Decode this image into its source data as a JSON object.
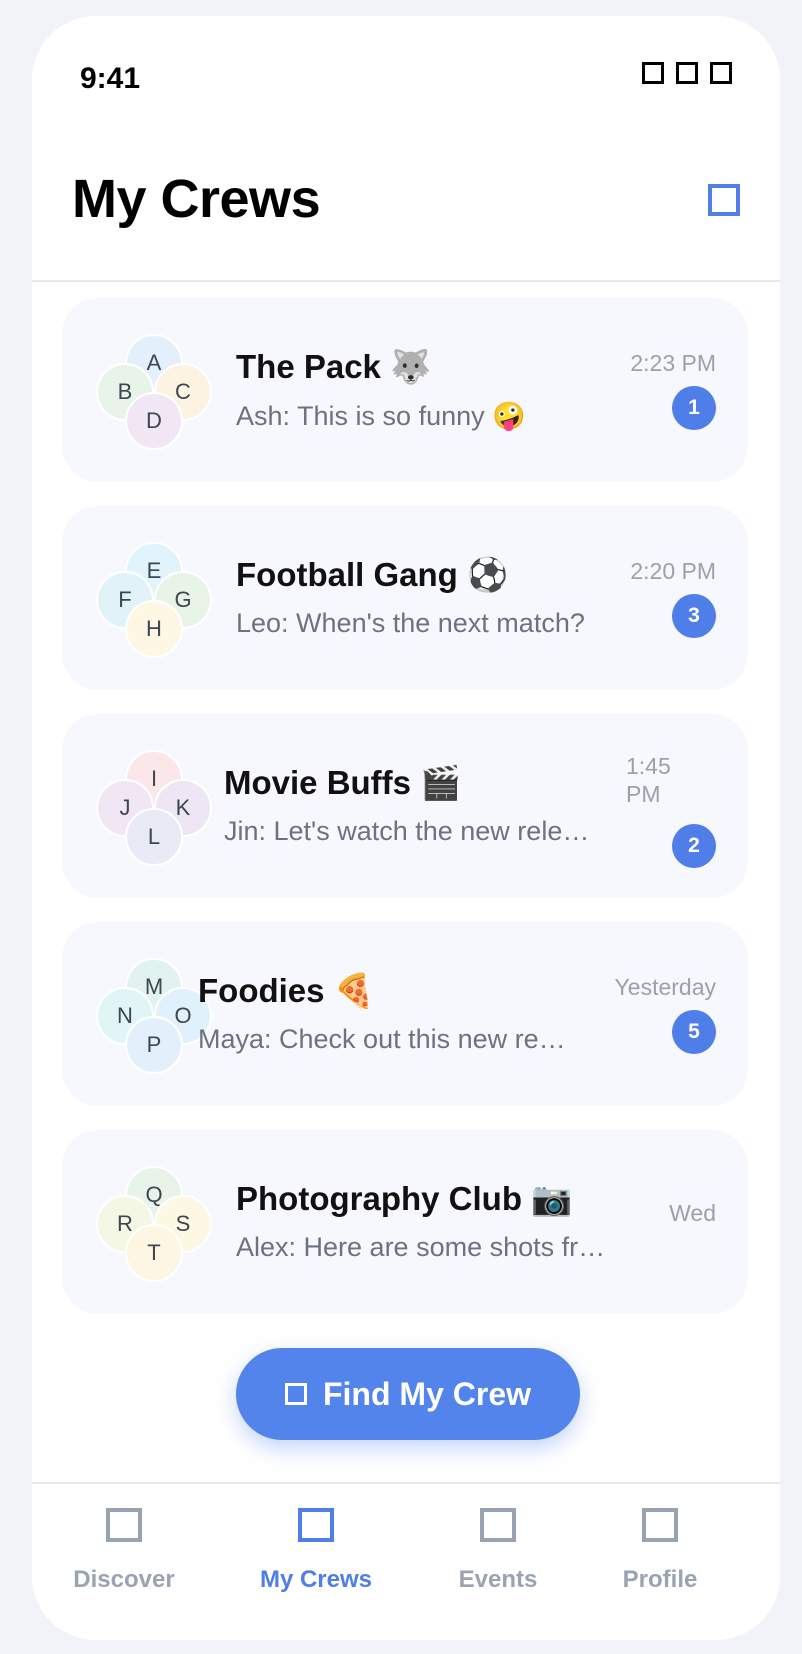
{
  "status_bar": {
    "time": "9:41"
  },
  "header": {
    "title": "My Crews"
  },
  "colors": {
    "accent": "#4f7ee8",
    "badge": "#4f7ee8",
    "card_bg": "#f7f8fe"
  },
  "crews": [
    {
      "name": "The Pack 🐺",
      "message": "Ash: This is so funny 🤪",
      "time": "2:23 PM",
      "unread": "1",
      "avatars": [
        {
          "letter": "A",
          "color": "#e3f0fb"
        },
        {
          "letter": "B",
          "color": "#e8f4ea"
        },
        {
          "letter": "C",
          "color": "#fdf3e3"
        },
        {
          "letter": "D",
          "color": "#f0e6f4"
        }
      ]
    },
    {
      "name": "Football Gang ⚽",
      "message": "Leo: When's the next match?",
      "time": "2:20 PM",
      "unread": "3",
      "avatars": [
        {
          "letter": "E",
          "color": "#e1f3fb"
        },
        {
          "letter": "F",
          "color": "#e1f3f9"
        },
        {
          "letter": "G",
          "color": "#e8f5e6"
        },
        {
          "letter": "H",
          "color": "#fdf7e3"
        }
      ]
    },
    {
      "name": "Movie Buffs 🎬",
      "message": "Jin: Let's watch the new rele…",
      "time": "1:45 PM",
      "unread": "2",
      "avatars": [
        {
          "letter": "I",
          "color": "#fbe6ea"
        },
        {
          "letter": "J",
          "color": "#f1e6f4"
        },
        {
          "letter": "K",
          "color": "#eee6f4"
        },
        {
          "letter": "L",
          "color": "#e8eaf5"
        }
      ]
    },
    {
      "name": "Foodies 🍕",
      "message": "Maya: Check out this new re…",
      "time": "Yesterday",
      "unread": "5",
      "avatars": [
        {
          "letter": "M",
          "color": "#e1f3ee"
        },
        {
          "letter": "N",
          "color": "#e1f4f6"
        },
        {
          "letter": "O",
          "color": "#e1f1fb"
        },
        {
          "letter": "P",
          "color": "#e3f0fb"
        }
      ]
    },
    {
      "name": "Photography Club 📷",
      "message": "Alex: Here are some shots fr…",
      "time": "Wed",
      "unread": "",
      "avatars": [
        {
          "letter": "Q",
          "color": "#e8f4ea"
        },
        {
          "letter": "R",
          "color": "#f3f7e3"
        },
        {
          "letter": "S",
          "color": "#fcf8e3"
        },
        {
          "letter": "T",
          "color": "#fdf6e3"
        }
      ]
    }
  ],
  "cta": {
    "label": "Find My Crew"
  },
  "tabs": [
    {
      "label": "Discover",
      "icon": "compass-icon",
      "active": false
    },
    {
      "label": "My Crews",
      "icon": "crews-icon",
      "active": true
    },
    {
      "label": "Events",
      "icon": "calendar-icon",
      "active": false
    },
    {
      "label": "Profile",
      "icon": "user-icon",
      "active": false
    }
  ]
}
